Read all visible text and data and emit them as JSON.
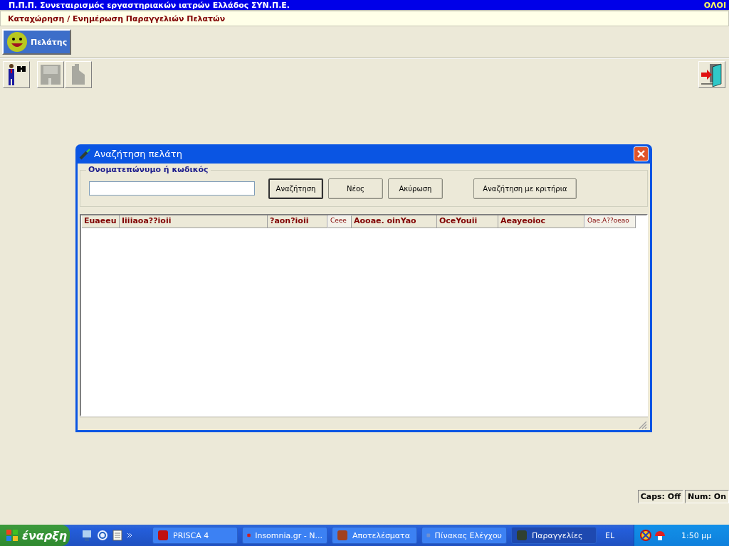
{
  "app_title": "Π.Π.Π. Συνεταιρισμός εργαστηριακών ιατρών Ελλάδος ΣΥΝ.Π.Ε.",
  "app_title_right": "ΟΛΟΙ",
  "subtitle": "Καταχώρηση / Ενημέρωση Παραγγελιών Πελατών",
  "module_tabs": [
    {
      "label": "Πελάτης",
      "selected": true
    }
  ],
  "toolbar": [
    {
      "kind": "find",
      "disabled": false
    },
    {
      "kind": "save",
      "disabled": true
    },
    {
      "kind": "print",
      "disabled": true
    }
  ],
  "dialog": {
    "title": "Αναζήτηση πελάτη",
    "group_label": "Ονοματεπώνυμο ή κωδικός",
    "buttons": [
      "Αναζήτηση",
      "Νέος",
      "Ακύρωση",
      "Αναζήτηση με κριτήρια"
    ],
    "columns": [
      {
        "label": "Euaeeu",
        "kind": "bold"
      },
      {
        "label": "Iiiiaoa??ioii",
        "kind": "bold"
      },
      {
        "label": "?aon?ioii",
        "kind": "bold"
      },
      {
        "label": "Ceee",
        "kind": "plain"
      },
      {
        "label": "Aooae. oinYao",
        "kind": "bold"
      },
      {
        "label": "OceYouii",
        "kind": "bold"
      },
      {
        "label": "Aeayeoioc",
        "kind": "bold"
      },
      {
        "label": "Oae.A??oeao",
        "kind": "plain"
      }
    ]
  },
  "status_panels": [
    "Caps: Off",
    "Num: On"
  ],
  "taskbar": {
    "start": "έναρξη",
    "tasks": [
      {
        "label": "PRISCA 4",
        "selected": false
      },
      {
        "label": "Insomnia.gr - N...",
        "selected": false
      },
      {
        "label": "Αποτελέσματα",
        "selected": false
      },
      {
        "label": "Πίνακας Ελέγχου",
        "selected": false
      },
      {
        "label": "Παραγγελίες",
        "selected": true
      }
    ],
    "language": "EL",
    "clock": "1:50 μμ"
  }
}
